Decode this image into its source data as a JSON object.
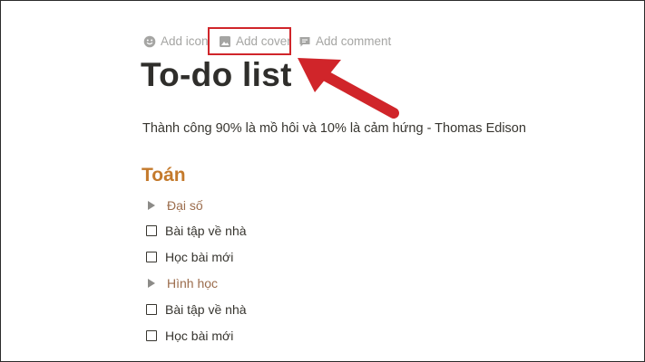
{
  "page_actions": {
    "add_icon": "Add icon",
    "add_cover": "Add cover",
    "add_comment": "Add comment"
  },
  "title": "To-do list",
  "quote": "Thành công 90% là mồ hôi và 10% là cảm hứng - Thomas Edison",
  "section_heading": "Toán",
  "items": [
    {
      "type": "toggle",
      "label": "Đại số"
    },
    {
      "type": "todo",
      "label": "Bài tập về nhà",
      "checked": false
    },
    {
      "type": "todo",
      "label": "Học bài mới",
      "checked": false
    },
    {
      "type": "toggle",
      "label": "Hình học"
    },
    {
      "type": "todo",
      "label": "Bài tập về nhà",
      "checked": false
    },
    {
      "type": "todo",
      "label": "Học bài mới",
      "checked": false
    }
  ],
  "colors": {
    "heading": "#c47a2c",
    "toggle_text": "#9b6c4c",
    "highlight": "#d0252a",
    "action_text": "#a5a5a3"
  }
}
